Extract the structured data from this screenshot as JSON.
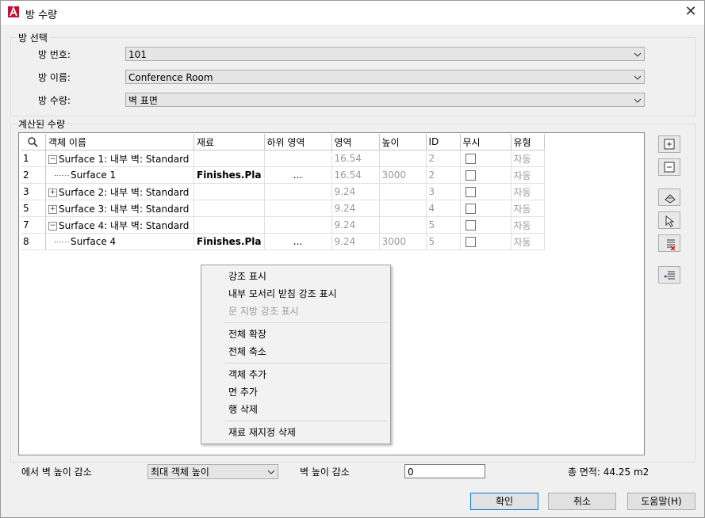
{
  "window": {
    "title": "방 수량"
  },
  "room_selection": {
    "group_label": "방 선택",
    "room_number": {
      "label": "방 번호:",
      "value": "101"
    },
    "room_name": {
      "label": "방 이름:",
      "value": "Conference Room"
    },
    "room_quantity": {
      "label": "방 수량:",
      "value": "벽 표면"
    }
  },
  "calculated": {
    "group_label": "계산된 수량",
    "columns": [
      "객체 이름",
      "재료",
      "하위 영역",
      "영역",
      "높이",
      "ID",
      "무시",
      "유형"
    ],
    "rows": [
      {
        "num": "1",
        "tree": "minus",
        "indent": false,
        "name": "Surface 1: 내부 벽: Standard",
        "material": "",
        "sub": "",
        "area": "16.54",
        "height": "",
        "id": "2",
        "type": "자동"
      },
      {
        "num": "2",
        "tree": "none",
        "indent": true,
        "name": "Surface 1",
        "material": "Finishes.Pla",
        "sub": "...",
        "area": "16.54",
        "height": "3000",
        "id": "2",
        "type": "자동"
      },
      {
        "num": "3",
        "tree": "plus",
        "indent": false,
        "name": "Surface 2: 내부 벽: Standard",
        "material": "",
        "sub": "",
        "area": "9.24",
        "height": "",
        "id": "3",
        "type": "자동"
      },
      {
        "num": "5",
        "tree": "plus",
        "indent": false,
        "name": "Surface 3: 내부 벽: Standard",
        "material": "",
        "sub": "",
        "area": "9.24",
        "height": "",
        "id": "4",
        "type": "자동"
      },
      {
        "num": "7",
        "tree": "minus",
        "indent": false,
        "name": "Surface 4: 내부 벽: Standard",
        "material": "",
        "sub": "",
        "area": "9.24",
        "height": "",
        "id": "5",
        "type": "자동"
      },
      {
        "num": "8",
        "tree": "none",
        "indent": true,
        "name": "Surface 4",
        "material": "Finishes.Pla",
        "sub": "...",
        "area": "9.24",
        "height": "3000",
        "id": "5",
        "type": "자동"
      }
    ]
  },
  "context_menu": {
    "items": [
      {
        "label": "강조 표시",
        "enabled": true
      },
      {
        "label": "내부 모서리 받침 강조 표시",
        "enabled": true
      },
      {
        "label": "문 지방 강조 표시",
        "enabled": false
      },
      {
        "label": "전체 확장",
        "enabled": true
      },
      {
        "label": "전체 축소",
        "enabled": true
      },
      {
        "label": "객체 추가",
        "enabled": true
      },
      {
        "label": "면 추가",
        "enabled": true
      },
      {
        "label": "행 삭제",
        "enabled": true
      },
      {
        "label": "재료 재지정 삭제",
        "enabled": true
      }
    ]
  },
  "bottom": {
    "reduce_from_label": "에서 벽 높이 감소",
    "reduce_from_value": "최대 객체 높이",
    "reduce_by_label": "벽 높이 감소",
    "reduce_by_value": "0",
    "total_area": "총 면적: 44.25 m2"
  },
  "buttons": {
    "ok": "확인",
    "cancel": "취소",
    "help": "도움말(H)"
  },
  "colors": {
    "accent": "#0078d7",
    "autocad_red": "#c8102e"
  }
}
